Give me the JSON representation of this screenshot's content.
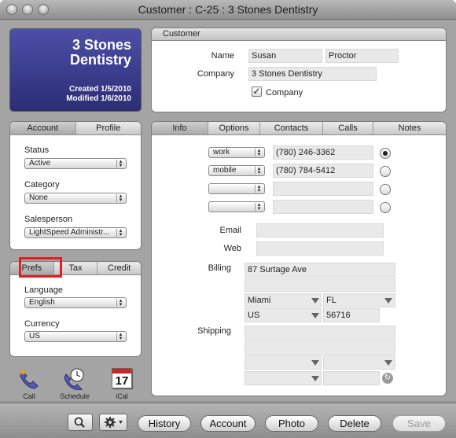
{
  "window": {
    "title": "Customer : C-25 : 3 Stones Dentistry"
  },
  "header_card": {
    "name_line1": "3 Stones",
    "name_line2": "Dentistry",
    "created": "Created 1/5/2010",
    "modified": "Modified 1/6/2010",
    "bg_color": "#3a3c8a"
  },
  "customer_panel": {
    "title": "Customer",
    "name_label": "Name",
    "first_name": "Susan",
    "last_name": "Proctor",
    "company_label": "Company",
    "company": "3 Stones Dentistry",
    "company_checkbox_label": "Company",
    "company_checked": true
  },
  "account_panel": {
    "tabs": [
      "Account",
      "Profile"
    ],
    "active_tab": "Account",
    "status_label": "Status",
    "status_value": "Active",
    "category_label": "Category",
    "category_value": "None",
    "salesperson_label": "Salesperson",
    "salesperson_value": "LightSpeed Administr..."
  },
  "prefs_panel": {
    "tabs": [
      "Prefs",
      "Tax",
      "Credit"
    ],
    "active_tab": "Prefs",
    "highlight_color": "#e02020",
    "language_label": "Language",
    "language_value": "English",
    "currency_label": "Currency",
    "currency_value": "US"
  },
  "info_panel": {
    "tabs": [
      "Info",
      "Options",
      "Contacts",
      "Calls",
      "Notes"
    ],
    "active_tab": "Info",
    "phones": [
      {
        "type": "work",
        "number": "(780) 246-3362",
        "primary": true
      },
      {
        "type": "mobile",
        "number": "(780) 784-5412",
        "primary": false
      },
      {
        "type": "",
        "number": "",
        "primary": false
      },
      {
        "type": "",
        "number": "",
        "primary": false
      }
    ],
    "email_label": "Email",
    "email_value": "",
    "web_label": "Web",
    "web_value": "",
    "billing_label": "Billing",
    "billing": {
      "street": "87 Surtage Ave",
      "city": "Miami",
      "state": "FL",
      "country": "US",
      "zip": "56716"
    },
    "shipping_label": "Shipping"
  },
  "dock": {
    "call_label": "Call",
    "schedule_label": "Schedule",
    "ical_label": "iCal",
    "ical_day": "17"
  },
  "toolbar": {
    "history": "History",
    "account": "Account",
    "photo": "Photo",
    "delete": "Delete",
    "save": "Save"
  }
}
